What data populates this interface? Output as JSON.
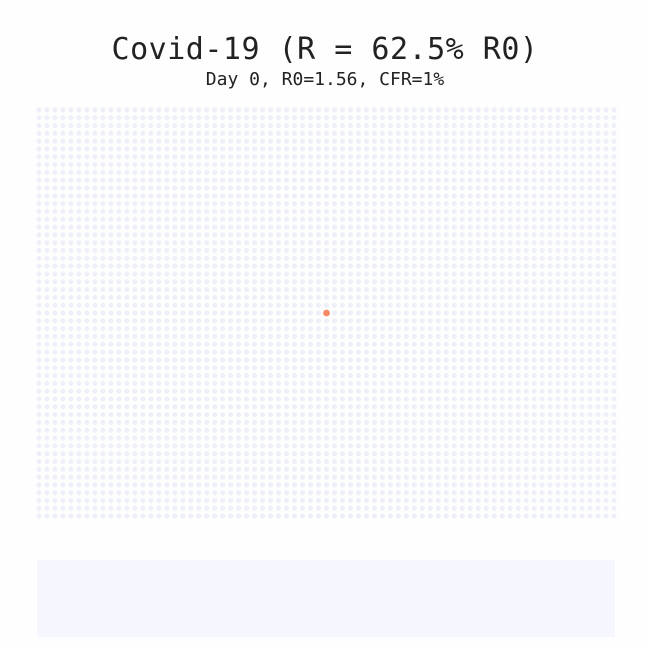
{
  "header": {
    "title": "Covid-19 (R = 62.5% R0)",
    "subtitle": "Day 0, R0=1.56, CFR=1%"
  },
  "simulation": {
    "day": 0,
    "r0": 1.56,
    "r_fraction_of_r0": 0.625,
    "cfr": 0.01,
    "grid_columns": 73,
    "grid_rows": 53,
    "infected_cells": [
      {
        "col": 36,
        "row": 26
      }
    ]
  },
  "colors": {
    "background": "#fefefe",
    "susceptible": "#eef0f9",
    "infected": "#f58a64",
    "timeline_panel": "#f6f7fe",
    "text": "#222222"
  },
  "timeline": {
    "series": []
  }
}
